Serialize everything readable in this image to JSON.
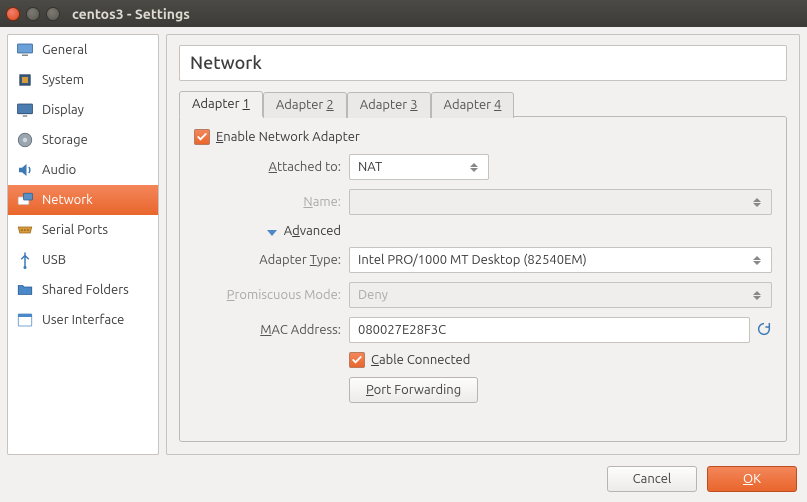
{
  "window": {
    "title": "centos3 - Settings"
  },
  "sidebar": {
    "items": [
      {
        "label": "General"
      },
      {
        "label": "System"
      },
      {
        "label": "Display"
      },
      {
        "label": "Storage"
      },
      {
        "label": "Audio"
      },
      {
        "label": "Network"
      },
      {
        "label": "Serial Ports"
      },
      {
        "label": "USB"
      },
      {
        "label": "Shared Folders"
      },
      {
        "label": "User Interface"
      }
    ]
  },
  "header": {
    "title": "Network"
  },
  "tabs": {
    "t1": "Adapter 1",
    "t2": "Adapter 2",
    "t3": "Adapter 3",
    "t4": "Adapter 4"
  },
  "form": {
    "enable_label": "Enable Network Adapter",
    "attached_label": "Attached to:",
    "attached_value": "NAT",
    "name_label": "Name:",
    "name_value": "",
    "advanced_label": "Advanced",
    "adapter_type_label": "Adapter Type:",
    "adapter_type_value": "Intel PRO/1000 MT Desktop (82540EM)",
    "promiscuous_label": "Promiscuous Mode:",
    "promiscuous_value": "Deny",
    "mac_label": "MAC Address:",
    "mac_value": "080027E28F3C",
    "cable_label": "Cable Connected",
    "port_forward_label": "Port Forwarding"
  },
  "footer": {
    "cancel": "Cancel",
    "ok": "OK"
  }
}
